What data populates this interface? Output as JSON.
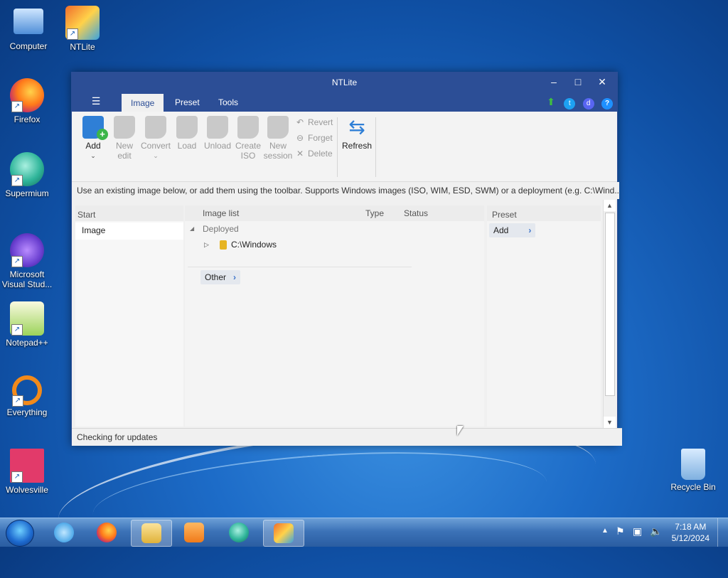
{
  "desktop": {
    "icons": [
      {
        "label": "Computer"
      },
      {
        "label": "NTLite"
      },
      {
        "label": "Firefox"
      },
      {
        "label": "Supermium"
      },
      {
        "label": "Microsoft Visual Stud..."
      },
      {
        "label": "Notepad++"
      },
      {
        "label": "Everything"
      },
      {
        "label": "Wolvesville"
      },
      {
        "label": "Recycle Bin"
      }
    ]
  },
  "window": {
    "title": "NTLite",
    "minimize_glyph": "–",
    "maximize_glyph": "□",
    "close_glyph": "✕"
  },
  "tabs": {
    "menu_glyph": "☰",
    "items": [
      {
        "label": "Image"
      },
      {
        "label": "Preset"
      },
      {
        "label": "Tools"
      }
    ]
  },
  "topicons": [
    "update-arrow-icon",
    "twitter-icon",
    "discord-icon",
    "help-icon"
  ],
  "ribbon": {
    "add": "Add",
    "new_edit_1": "New",
    "new_edit_2": "edit",
    "convert": "Convert",
    "load": "Load",
    "unload": "Unload",
    "create_iso_1": "Create",
    "create_iso_2": "ISO",
    "new_session_1": "New",
    "new_session_2": "session",
    "revert": "Revert",
    "forget": "Forget",
    "delete": "Delete",
    "refresh": "Refresh"
  },
  "info_bar": "Use an existing image below, or add them using the toolbar. Supports Windows images (ISO, WIM, ESD, SWM) or a deployment (e.g. C:\\Wind...",
  "start_pane": {
    "header": "Start",
    "items": [
      {
        "label": "Image"
      }
    ]
  },
  "image_list": {
    "headers": {
      "name": "Image list",
      "type": "Type",
      "status": "Status"
    },
    "groups": [
      {
        "label": "Deployed",
        "children": [
          {
            "label": "C:\\Windows"
          }
        ]
      }
    ],
    "other_label": "Other"
  },
  "preset_pane": {
    "header": "Preset",
    "add_label": "Add"
  },
  "status_bar": "Checking for updates",
  "taskbar": {
    "clock_time": "7:18 AM",
    "clock_date": "5/12/2024"
  }
}
